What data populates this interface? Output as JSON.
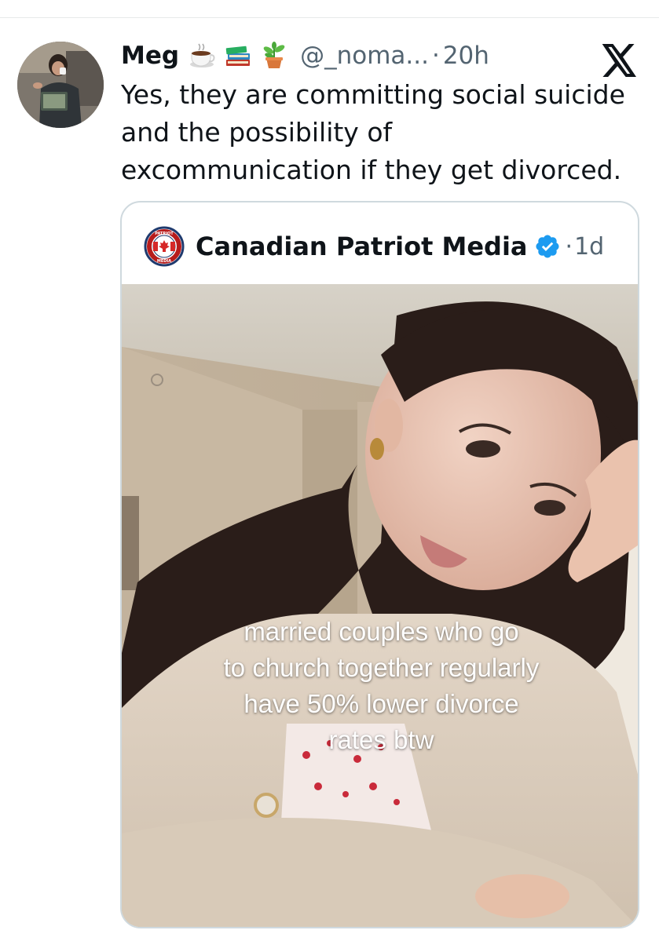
{
  "tweet": {
    "author": {
      "display_name": "Meg",
      "emojis": [
        "coffee-icon",
        "books-icon",
        "plant-icon"
      ],
      "handle": "@_noma...",
      "separator": "·",
      "time": "20h"
    },
    "platform_logo": "x-logo-icon",
    "text_lines": [
      "Yes, they are committing social suicide",
      "and the possibility of",
      "excommunication if they get divorced."
    ]
  },
  "quote": {
    "author": {
      "display_name": "Canadian Patriot Media",
      "verified": true,
      "separator": "·",
      "time": "1d",
      "avatar_text_top": "PATRIOT",
      "avatar_text_bottom": "MEDIA"
    },
    "media": {
      "caption_lines": [
        "married couples who go",
        "to church together regularly",
        "have 50% lower divorce",
        "rates btw"
      ]
    }
  },
  "colors": {
    "text_primary": "#0f1419",
    "text_secondary": "#536471",
    "border": "#cfd9de",
    "verified_blue": "#1d9bf0"
  }
}
